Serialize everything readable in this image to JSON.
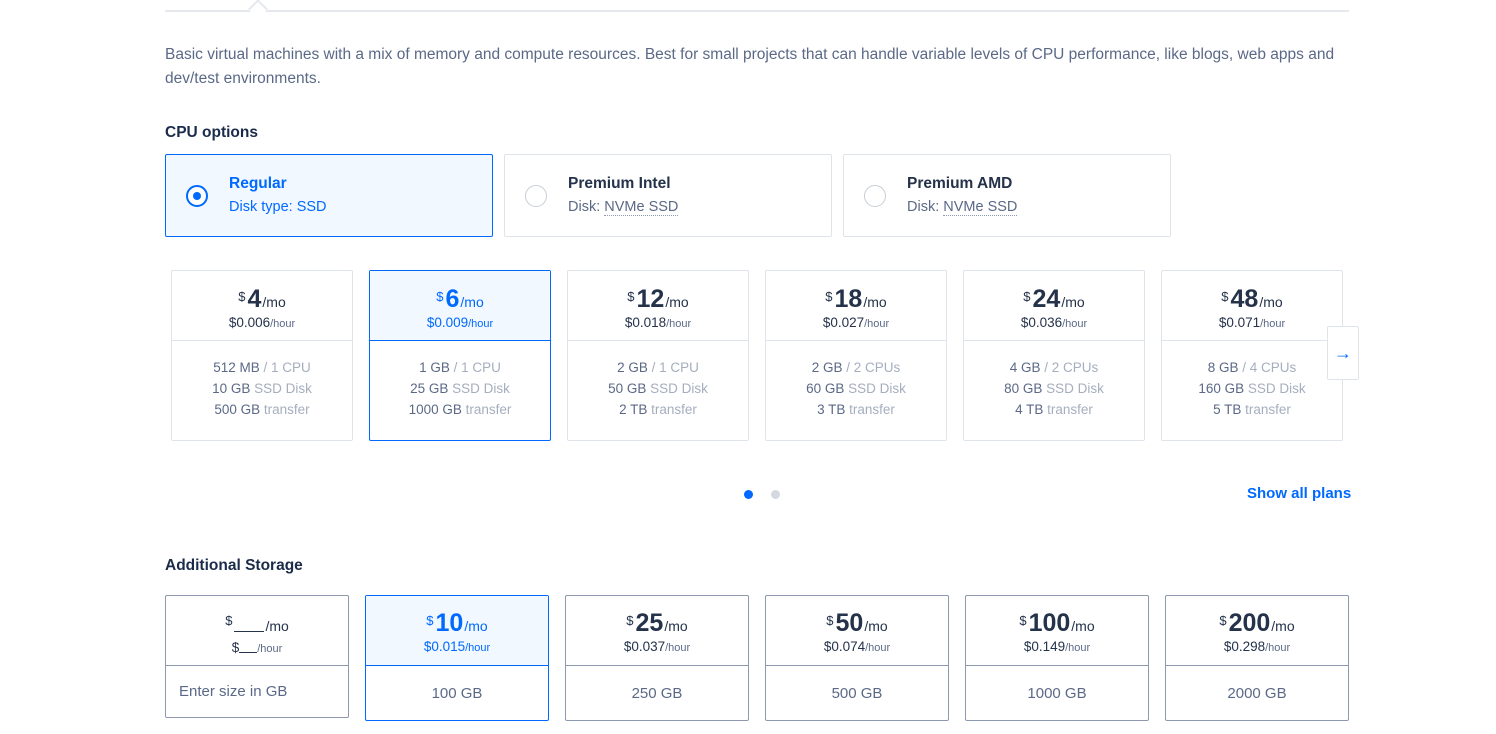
{
  "description": "Basic virtual machines with a mix of memory and compute resources. Best for small projects that can handle variable levels of CPU performance, like blogs, web apps and dev/test environments.",
  "cpu_section": {
    "title": "CPU options",
    "options": [
      {
        "name": "Regular",
        "disk_prefix": "Disk type: ",
        "disk_value": "SSD",
        "selected": true
      },
      {
        "name": "Premium Intel",
        "disk_prefix": "Disk: ",
        "disk_value": "NVMe SSD",
        "selected": false
      },
      {
        "name": "Premium AMD",
        "disk_prefix": "Disk: ",
        "disk_value": "NVMe SSD",
        "selected": false
      }
    ]
  },
  "plans": [
    {
      "currency": "$",
      "amount": "4",
      "per": "/mo",
      "hourly": "$0.006",
      "hour_unit": "/hour",
      "memory": "512 MB",
      "cpu": " / 1 CPU",
      "disk": "10 GB",
      "disk_type": " SSD Disk",
      "transfer": "500 GB",
      "transfer_label": " transfer",
      "selected": false
    },
    {
      "currency": "$",
      "amount": "6",
      "per": "/mo",
      "hourly": "$0.009",
      "hour_unit": "/hour",
      "memory": "1 GB",
      "cpu": " / 1 CPU",
      "disk": "25 GB",
      "disk_type": " SSD Disk",
      "transfer": "1000 GB",
      "transfer_label": " transfer",
      "selected": true
    },
    {
      "currency": "$",
      "amount": "12",
      "per": "/mo",
      "hourly": "$0.018",
      "hour_unit": "/hour",
      "memory": "2 GB",
      "cpu": " / 1 CPU",
      "disk": "50 GB",
      "disk_type": " SSD Disk",
      "transfer": "2 TB",
      "transfer_label": " transfer",
      "selected": false
    },
    {
      "currency": "$",
      "amount": "18",
      "per": "/mo",
      "hourly": "$0.027",
      "hour_unit": "/hour",
      "memory": "2 GB",
      "cpu": " / 2 CPUs",
      "disk": "60 GB",
      "disk_type": " SSD Disk",
      "transfer": "3 TB",
      "transfer_label": " transfer",
      "selected": false
    },
    {
      "currency": "$",
      "amount": "24",
      "per": "/mo",
      "hourly": "$0.036",
      "hour_unit": "/hour",
      "memory": "4 GB",
      "cpu": " / 2 CPUs",
      "disk": "80 GB",
      "disk_type": " SSD Disk",
      "transfer": "4 TB",
      "transfer_label": " transfer",
      "selected": false
    },
    {
      "currency": "$",
      "amount": "48",
      "per": "/mo",
      "hourly": "$0.071",
      "hour_unit": "/hour",
      "memory": "8 GB",
      "cpu": " / 4 CPUs",
      "disk": "160 GB",
      "disk_type": " SSD Disk",
      "transfer": "5 TB",
      "transfer_label": " transfer",
      "selected": false
    }
  ],
  "carousel": {
    "next_icon": "arrow-right-icon",
    "next_glyph": "→",
    "pages": 2,
    "active_page": 1
  },
  "show_all_plans": "Show all plans",
  "storage_section": {
    "title": "Additional Storage",
    "custom": {
      "currency": "$",
      "per": "/mo",
      "hour_currency": "$",
      "hour_unit": "/hour",
      "placeholder": "Enter size in GB"
    },
    "options": [
      {
        "currency": "$",
        "amount": "10",
        "per": "/mo",
        "hourly": "$0.015",
        "hour_unit": "/hour",
        "size": "100 GB",
        "selected": true
      },
      {
        "currency": "$",
        "amount": "25",
        "per": "/mo",
        "hourly": "$0.037",
        "hour_unit": "/hour",
        "size": "250 GB",
        "selected": false
      },
      {
        "currency": "$",
        "amount": "50",
        "per": "/mo",
        "hourly": "$0.074",
        "hour_unit": "/hour",
        "size": "500 GB",
        "selected": false
      },
      {
        "currency": "$",
        "amount": "100",
        "per": "/mo",
        "hourly": "$0.149",
        "hour_unit": "/hour",
        "size": "1000 GB",
        "selected": false
      },
      {
        "currency": "$",
        "amount": "200",
        "per": "/mo",
        "hourly": "$0.298",
        "hour_unit": "/hour",
        "size": "2000 GB",
        "selected": false
      }
    ]
  },
  "colors": {
    "accent": "#0069ff",
    "text": "#24324a",
    "muted": "#5b6987",
    "border": "#dfe3ea",
    "selected_bg": "#f2f8ff"
  }
}
